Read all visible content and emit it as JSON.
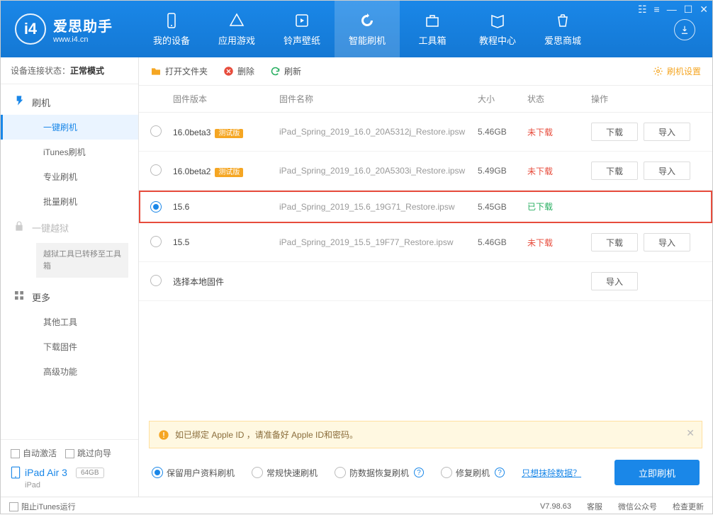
{
  "logo": {
    "cn": "爱思助手",
    "en": "www.i4.cn",
    "glyph": "i4"
  },
  "nav": [
    {
      "label": "我的设备"
    },
    {
      "label": "应用游戏"
    },
    {
      "label": "铃声壁纸"
    },
    {
      "label": "智能刷机",
      "active": true
    },
    {
      "label": "工具箱"
    },
    {
      "label": "教程中心"
    },
    {
      "label": "爱思商城"
    }
  ],
  "sidebar": {
    "status_label": "设备连接状态：",
    "status_value": "正常模式",
    "groups": {
      "flash": {
        "label": "刷机"
      },
      "jailbreak": {
        "label": "一键越狱"
      },
      "jailbreak_note": "越狱工具已转移至工具箱",
      "more": {
        "label": "更多"
      }
    },
    "items": {
      "one_click": "一键刷机",
      "itunes": "iTunes刷机",
      "pro": "专业刷机",
      "batch": "批量刷机",
      "other_tools": "其他工具",
      "download_fw": "下载固件",
      "advanced": "高级功能"
    },
    "bottom": {
      "auto_activate": "自动激活",
      "skip_guide": "跳过向导",
      "device_name": "iPad Air 3",
      "capacity": "64GB",
      "device_type": "iPad"
    }
  },
  "toolbar": {
    "open": "打开文件夹",
    "delete": "删除",
    "refresh": "刷新",
    "settings": "刷机设置"
  },
  "table": {
    "headers": {
      "version": "固件版本",
      "name": "固件名称",
      "size": "大小",
      "status": "状态",
      "ops": "操作"
    },
    "rows": [
      {
        "version": "16.0beta3",
        "tag": "测试版",
        "name": "iPad_Spring_2019_16.0_20A5312j_Restore.ipsw",
        "size": "5.46GB",
        "status": "未下载",
        "downloaded": false,
        "selected": false
      },
      {
        "version": "16.0beta2",
        "tag": "测试版",
        "name": "iPad_Spring_2019_16.0_20A5303i_Restore.ipsw",
        "size": "5.49GB",
        "status": "未下载",
        "downloaded": false,
        "selected": false
      },
      {
        "version": "15.6",
        "name": "iPad_Spring_2019_15.6_19G71_Restore.ipsw",
        "size": "5.45GB",
        "status": "已下载",
        "downloaded": true,
        "selected": true,
        "highlighted": true
      },
      {
        "version": "15.5",
        "name": "iPad_Spring_2019_15.5_19F77_Restore.ipsw",
        "size": "5.46GB",
        "status": "未下载",
        "downloaded": false,
        "selected": false
      }
    ],
    "local_firmware": "选择本地固件",
    "btn_download": "下载",
    "btn_import": "导入"
  },
  "warning": "如已绑定 Apple ID ，请准备好 Apple ID和密码。",
  "actions": {
    "opts": [
      "保留用户资料刷机",
      "常规快速刷机",
      "防数据恢复刷机",
      "修复刷机"
    ],
    "erase_link": "只想抹除数据？",
    "flash_btn": "立即刷机"
  },
  "footer": {
    "block_itunes": "阻止iTunes运行",
    "version": "V7.98.63",
    "support": "客服",
    "wechat": "微信公众号",
    "update": "检查更新"
  }
}
